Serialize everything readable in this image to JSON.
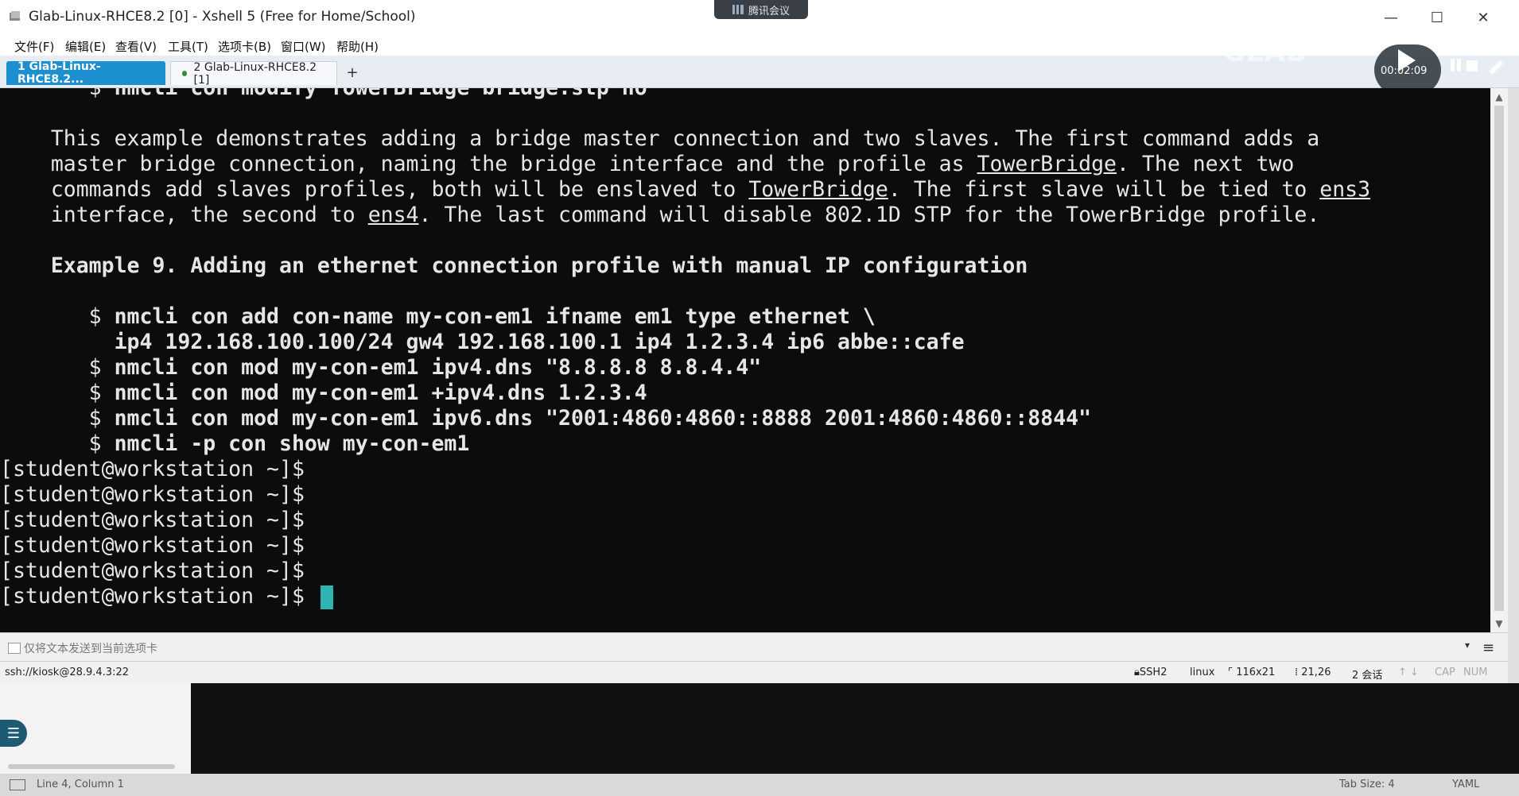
{
  "window": {
    "title": "Glab-Linux-RHCE8.2 [0] - Xshell 5 (Free for Home/School)",
    "meeting_badge": "腾讯会议",
    "minimize_glyph": "—",
    "maximize_glyph": "☐",
    "close_glyph": "✕"
  },
  "menu": [
    "文件(F)",
    "编辑(E)",
    "查看(V)",
    "工具(T)",
    "选项卡(B)",
    "窗口(W)",
    "帮助(H)"
  ],
  "tabs": [
    {
      "label": "1 Glab-Linux-RHCE8.2...",
      "active": true
    },
    {
      "label": "2 Glab-Linux-RHCE8.2 [1]",
      "active": false
    }
  ],
  "tab_add": "+",
  "recorder": {
    "time": "00:02:09",
    "watermark": "GLAB"
  },
  "terminal": {
    "lines": [
      [
        {
          "t": "       $ "
        },
        {
          "t": "nmcli con modify TowerBridge bridge.stp no",
          "b": true
        }
      ],
      [
        {
          "t": ""
        }
      ],
      [
        {
          "t": "    This example demonstrates adding a bridge master connection and two slaves. The first command adds a"
        }
      ],
      [
        {
          "t": "    master bridge connection, naming the bridge interface and the profile as "
        },
        {
          "t": "TowerBridge",
          "u": true
        },
        {
          "t": ". The next two"
        }
      ],
      [
        {
          "t": "    commands add slaves profiles, both will be enslaved to "
        },
        {
          "t": "TowerBridge",
          "u": true
        },
        {
          "t": ". The first slave will be tied to "
        },
        {
          "t": "ens3",
          "u": true
        }
      ],
      [
        {
          "t": "    interface, the second to "
        },
        {
          "t": "ens4",
          "u": true
        },
        {
          "t": ". The last command will disable 802.1D STP for the TowerBridge profile."
        }
      ],
      [
        {
          "t": ""
        }
      ],
      [
        {
          "t": "    Example 9. Adding an ethernet connection profile with manual IP configuration",
          "b": true
        }
      ],
      [
        {
          "t": ""
        }
      ],
      [
        {
          "t": "       $ "
        },
        {
          "t": "nmcli con add con-name my-con-em1 ifname em1 type ethernet \\",
          "b": true
        }
      ],
      [
        {
          "t": "         "
        },
        {
          "t": "ip4 192.168.100.100/24 gw4 192.168.100.1 ip4 1.2.3.4 ip6 abbe::cafe",
          "b": true
        }
      ],
      [
        {
          "t": "       $ "
        },
        {
          "t": "nmcli con mod my-con-em1 ipv4.dns \"8.8.8.8 8.8.4.4\"",
          "b": true
        }
      ],
      [
        {
          "t": "       $ "
        },
        {
          "t": "nmcli con mod my-con-em1 +ipv4.dns 1.2.3.4",
          "b": true
        }
      ],
      [
        {
          "t": "       $ "
        },
        {
          "t": "nmcli con mod my-con-em1 ipv6.dns \"2001:4860:4860::8888 2001:4860:4860::8844\"",
          "b": true
        }
      ],
      [
        {
          "t": "       $ "
        },
        {
          "t": "nmcli -p con show my-con-em1",
          "b": true
        }
      ],
      [
        {
          "t": "[student@workstation ~]$"
        }
      ],
      [
        {
          "t": "[student@workstation ~]$"
        }
      ],
      [
        {
          "t": "[student@workstation ~]$"
        }
      ],
      [
        {
          "t": "[student@workstation ~]$"
        }
      ],
      [
        {
          "t": "[student@workstation ~]$"
        }
      ],
      [
        {
          "t": "[student@workstation ~]$ "
        }
      ]
    ]
  },
  "compose": {
    "placeholder": "仅将文本发送到当前选项卡"
  },
  "status": {
    "connection": "ssh://kiosk@28.9.4.3:22",
    "protocol": "SSH2",
    "term": "linux",
    "size": "116x21",
    "cursor_pos": "21,26",
    "sessions": "2 会话",
    "cap": "CAP",
    "num": "NUM"
  },
  "editor_status": {
    "position": "Line 4, Column 1",
    "tab_size": "Tab Size: 4",
    "language": "YAML"
  },
  "colors": {
    "terminal_bg": "#0c0c0c",
    "terminal_fg": "#e6e6e6",
    "cursor": "#2fb4b4",
    "active_tab": "#1b8fd0"
  }
}
